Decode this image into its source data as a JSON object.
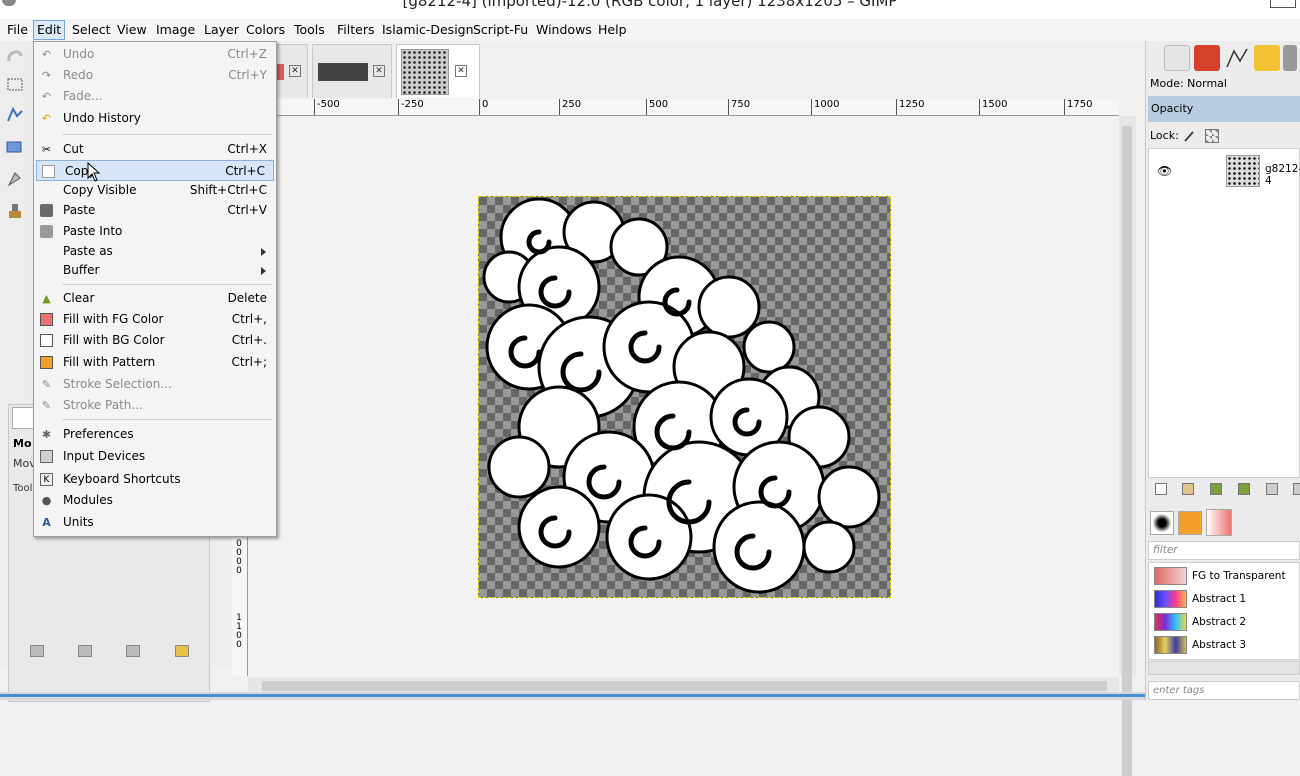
{
  "window": {
    "title": "[g8212-4] (imported)-12.0 (RGB color, 1 layer) 1238x1205 – GIMP"
  },
  "menubar": [
    "File",
    "Edit",
    "Select",
    "View",
    "Image",
    "Layer",
    "Colors",
    "Tools",
    "Filters",
    "Islamic-Design",
    "Script-Fu",
    "Windows",
    "Help"
  ],
  "edit_menu": {
    "undo": {
      "label": "Undo",
      "shortcut": "Ctrl+Z"
    },
    "redo": {
      "label": "Redo",
      "shortcut": "Ctrl+Y"
    },
    "fade": {
      "label": "Fade..."
    },
    "undo_history": {
      "label": "Undo History"
    },
    "cut": {
      "label": "Cut",
      "shortcut": "Ctrl+X"
    },
    "copy": {
      "label": "Copy",
      "shortcut": "Ctrl+C"
    },
    "copy_visible": {
      "label": "Copy Visible",
      "shortcut": "Shift+Ctrl+C"
    },
    "paste": {
      "label": "Paste",
      "shortcut": "Ctrl+V"
    },
    "paste_into": {
      "label": "Paste Into"
    },
    "paste_as": {
      "label": "Paste as"
    },
    "buffer": {
      "label": "Buffer"
    },
    "clear": {
      "label": "Clear",
      "shortcut": "Delete"
    },
    "fill_fg": {
      "label": "Fill with FG Color",
      "shortcut": "Ctrl+,"
    },
    "fill_bg": {
      "label": "Fill with BG Color",
      "shortcut": "Ctrl+."
    },
    "fill_pattern": {
      "label": "Fill with Pattern",
      "shortcut": "Ctrl+;"
    },
    "stroke_selection": {
      "label": "Stroke Selection..."
    },
    "stroke_path": {
      "label": "Stroke Path..."
    },
    "preferences": {
      "label": "Preferences"
    },
    "input_devices": {
      "label": "Input Devices"
    },
    "keyboard_shortcuts": {
      "label": "Keyboard Shortcuts"
    },
    "modules": {
      "label": "Modules"
    },
    "units": {
      "label": "Units"
    }
  },
  "ruler": {
    "h_labels": [
      "-500",
      "-250",
      "0",
      "250",
      "500",
      "750",
      "1000",
      "1250",
      "1500",
      "1750"
    ],
    "v_top": [
      "0",
      "0",
      "0",
      "0"
    ],
    "v_bottom": [
      "1",
      "1",
      "0",
      "0"
    ]
  },
  "toolbox": {
    "labels": [
      "Mo",
      "Mov",
      "Tool"
    ]
  },
  "layers_panel": {
    "mode": "Mode: Normal",
    "opacity": "Opacity",
    "lock": "Lock:",
    "layer_name": "g8212-4"
  },
  "gradients_panel": {
    "filter_placeholder": "filter",
    "items": [
      "FG to Transparent",
      "Abstract 1",
      "Abstract 2",
      "Abstract 3"
    ],
    "tags_placeholder": "enter tags"
  },
  "colors": {
    "accent": "#4a8cd8",
    "menu_highlight": "#d7e6f7",
    "fg_swatch": "#e8736f",
    "pattern_swatch": "#f2a02a"
  }
}
